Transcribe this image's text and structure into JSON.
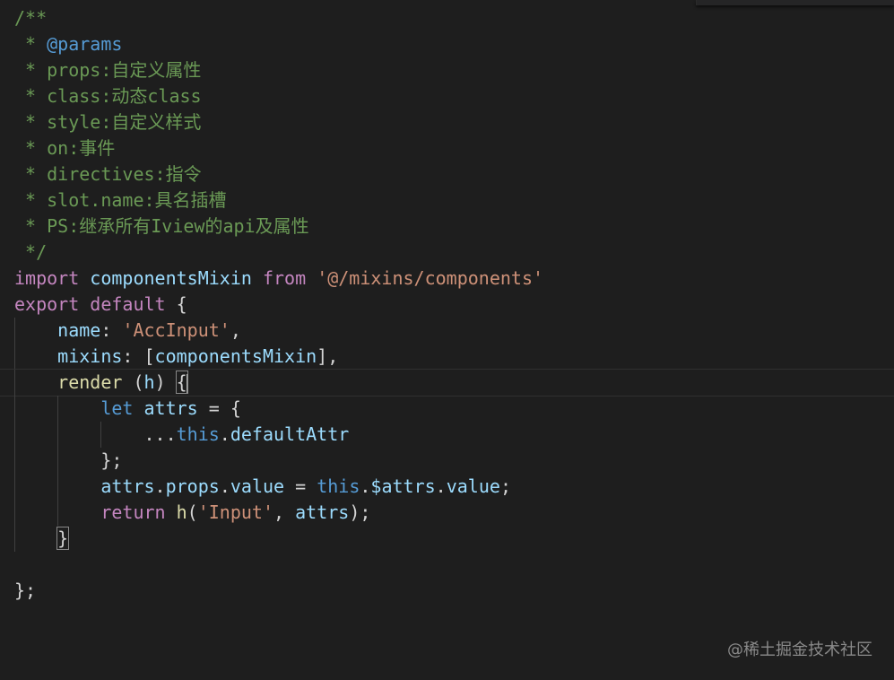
{
  "editor": {
    "lines": [
      {
        "tokens": [
          {
            "t": "/**",
            "c": "comment"
          }
        ]
      },
      {
        "tokens": [
          {
            "t": " * ",
            "c": "comment"
          },
          {
            "t": "@params",
            "c": "tag"
          }
        ]
      },
      {
        "tokens": [
          {
            "t": " * props:自定义属性",
            "c": "comment"
          }
        ]
      },
      {
        "tokens": [
          {
            "t": " * class:动态class",
            "c": "comment"
          }
        ]
      },
      {
        "tokens": [
          {
            "t": " * style:自定义样式",
            "c": "comment"
          }
        ]
      },
      {
        "tokens": [
          {
            "t": " * on:事件",
            "c": "comment"
          }
        ]
      },
      {
        "tokens": [
          {
            "t": " * directives:指令",
            "c": "comment"
          }
        ]
      },
      {
        "tokens": [
          {
            "t": " * slot.name:具名插槽",
            "c": "comment"
          }
        ]
      },
      {
        "tokens": [
          {
            "t": " * PS:继承所有Iview的api及属性",
            "c": "comment"
          }
        ]
      },
      {
        "tokens": [
          {
            "t": " */",
            "c": "comment"
          }
        ]
      },
      {
        "tokens": [
          {
            "t": "import",
            "c": "keyword"
          },
          {
            "t": " ",
            "c": "plain"
          },
          {
            "t": "componentsMixin",
            "c": "var"
          },
          {
            "t": " ",
            "c": "plain"
          },
          {
            "t": "from",
            "c": "keyword"
          },
          {
            "t": " ",
            "c": "plain"
          },
          {
            "t": "'@/mixins/components'",
            "c": "string"
          }
        ]
      },
      {
        "tokens": [
          {
            "t": "export",
            "c": "keyword"
          },
          {
            "t": " ",
            "c": "plain"
          },
          {
            "t": "default",
            "c": "keyword"
          },
          {
            "t": " {",
            "c": "plain"
          }
        ]
      },
      {
        "guides": 1,
        "tokens": [
          {
            "t": "    ",
            "c": "plain"
          },
          {
            "t": "name",
            "c": "var"
          },
          {
            "t": ": ",
            "c": "plain"
          },
          {
            "t": "'AccInput'",
            "c": "string"
          },
          {
            "t": ",",
            "c": "plain"
          }
        ]
      },
      {
        "guides": 1,
        "tokens": [
          {
            "t": "    ",
            "c": "plain"
          },
          {
            "t": "mixins",
            "c": "var"
          },
          {
            "t": ": [",
            "c": "plain"
          },
          {
            "t": "componentsMixin",
            "c": "var"
          },
          {
            "t": "],",
            "c": "plain"
          }
        ]
      },
      {
        "guides": 1,
        "current": true,
        "tokens": [
          {
            "t": "    ",
            "c": "plain"
          },
          {
            "t": "render",
            "c": "func"
          },
          {
            "t": " (",
            "c": "plain"
          },
          {
            "t": "h",
            "c": "var"
          },
          {
            "t": ") ",
            "c": "plain"
          },
          {
            "t": "{",
            "c": "plain",
            "match": true
          },
          {
            "t": "",
            "c": "cursor"
          }
        ]
      },
      {
        "guides": 2,
        "tokens": [
          {
            "t": "        ",
            "c": "plain"
          },
          {
            "t": "let",
            "c": "let"
          },
          {
            "t": " ",
            "c": "plain"
          },
          {
            "t": "attrs",
            "c": "var"
          },
          {
            "t": " = {",
            "c": "plain"
          }
        ]
      },
      {
        "guides": 3,
        "tokens": [
          {
            "t": "            ...",
            "c": "plain"
          },
          {
            "t": "this",
            "c": "this"
          },
          {
            "t": ".",
            "c": "plain"
          },
          {
            "t": "defaultAttr",
            "c": "var"
          }
        ]
      },
      {
        "guides": 2,
        "tokens": [
          {
            "t": "        };",
            "c": "plain"
          }
        ]
      },
      {
        "guides": 2,
        "tokens": [
          {
            "t": "        ",
            "c": "plain"
          },
          {
            "t": "attrs",
            "c": "var"
          },
          {
            "t": ".",
            "c": "plain"
          },
          {
            "t": "props",
            "c": "var"
          },
          {
            "t": ".",
            "c": "plain"
          },
          {
            "t": "value",
            "c": "var"
          },
          {
            "t": " = ",
            "c": "plain"
          },
          {
            "t": "this",
            "c": "this"
          },
          {
            "t": ".",
            "c": "plain"
          },
          {
            "t": "$attrs",
            "c": "var"
          },
          {
            "t": ".",
            "c": "plain"
          },
          {
            "t": "value",
            "c": "var"
          },
          {
            "t": ";",
            "c": "plain"
          }
        ]
      },
      {
        "guides": 2,
        "tokens": [
          {
            "t": "        ",
            "c": "plain"
          },
          {
            "t": "return",
            "c": "keyword"
          },
          {
            "t": " ",
            "c": "plain"
          },
          {
            "t": "h",
            "c": "func"
          },
          {
            "t": "(",
            "c": "plain"
          },
          {
            "t": "'Input'",
            "c": "string"
          },
          {
            "t": ", ",
            "c": "plain"
          },
          {
            "t": "attrs",
            "c": "var"
          },
          {
            "t": ");",
            "c": "plain"
          }
        ]
      },
      {
        "guides": 1,
        "tokens": [
          {
            "t": "    ",
            "c": "plain"
          },
          {
            "t": "}",
            "c": "plain",
            "match": true
          }
        ]
      },
      {
        "tokens": []
      },
      {
        "tokens": [
          {
            "t": "};",
            "c": "plain"
          }
        ]
      }
    ]
  },
  "watermark": {
    "text": "@稀土掘金技术社区"
  },
  "colors": {
    "background": "#1e1e1e",
    "comment": "#6a9955",
    "keyword": "#c586c0",
    "variable": "#9cdcfe",
    "string": "#ce9178",
    "function": "#dcdcaa",
    "this_keyword": "#569cd6"
  }
}
